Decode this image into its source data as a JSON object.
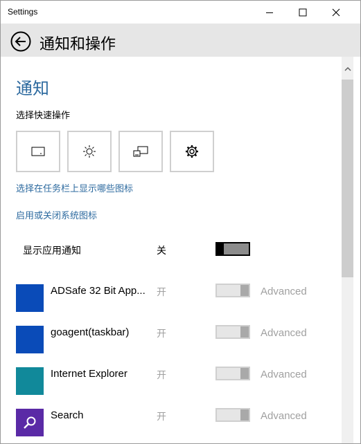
{
  "window": {
    "title": "Settings"
  },
  "header": {
    "page_title": "通知和操作"
  },
  "notifications": {
    "section_title": "通知",
    "quick_actions_heading": "选择快速操作",
    "quick_actions": [
      {
        "icon": "tablet-mode-icon"
      },
      {
        "icon": "brightness-icon"
      },
      {
        "icon": "project-icon"
      },
      {
        "icon": "settings-gear-icon"
      }
    ],
    "link_taskbar_icons": "选择在任务栏上显示哪些图标",
    "link_system_icons": "启用或关闭系统图标",
    "show_app_notifications": {
      "label": "显示应用通知",
      "state": "关",
      "on": false
    },
    "apps": [
      {
        "name": "ADSafe 32 Bit App...",
        "state": "开",
        "on": true,
        "advanced": "Advanced",
        "color": "#0a4bb8",
        "icon": "app-tile-icon"
      },
      {
        "name": "goagent(taskbar)",
        "state": "开",
        "on": true,
        "advanced": "Advanced",
        "color": "#0a4bb8",
        "icon": "app-tile-icon"
      },
      {
        "name": "Internet Explorer",
        "state": "开",
        "on": true,
        "advanced": "Advanced",
        "color": "#11899a",
        "icon": "app-tile-icon"
      },
      {
        "name": "Search",
        "state": "开",
        "on": true,
        "advanced": "Advanced",
        "color": "#5a2aa6",
        "icon": "search-icon"
      }
    ]
  },
  "colors": {
    "accent": "#2d6a9f",
    "disabled_text": "#a0a0a0",
    "header_bg": "#e6e6e6"
  }
}
